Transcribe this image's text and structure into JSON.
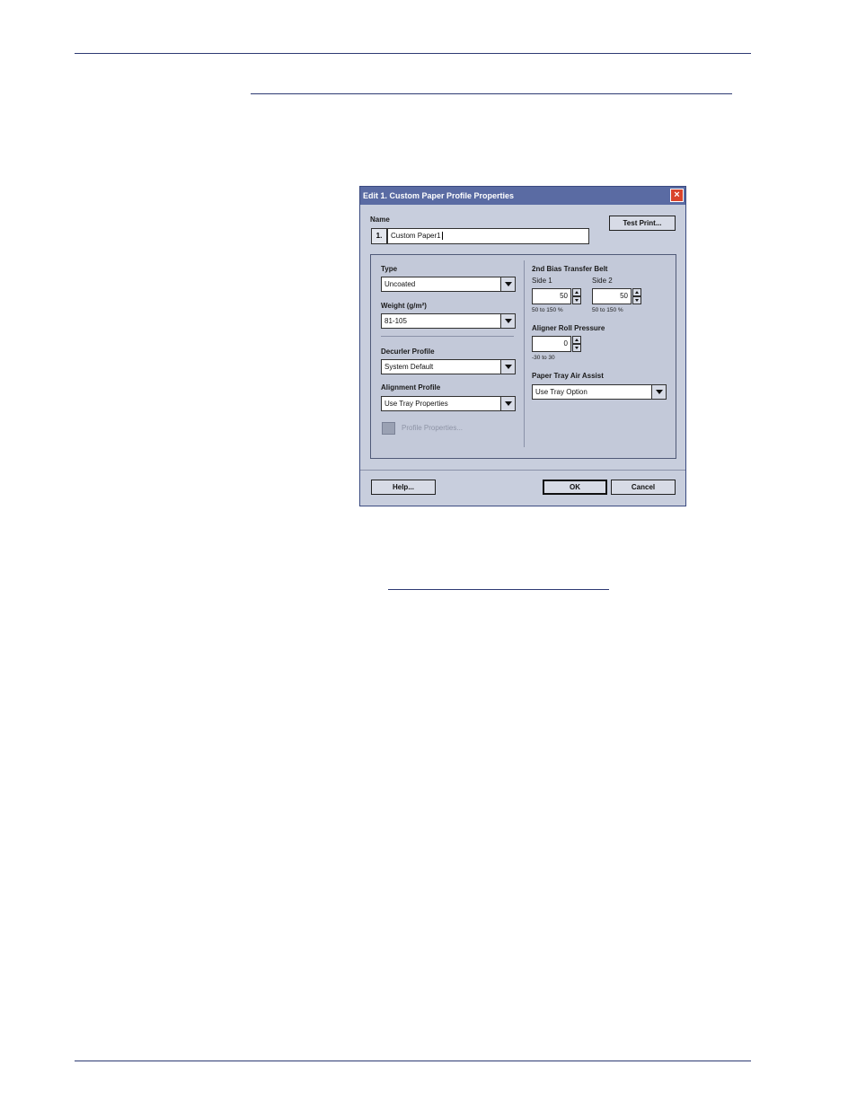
{
  "dialog": {
    "title": "Edit 1. Custom Paper Profile Properties",
    "close_glyph": "×",
    "name_label": "Name",
    "name_index": "1.",
    "name_value": "Custom Paper1",
    "test_print_label": "Test Print...",
    "type_label": "Type",
    "type_value": "Uncoated",
    "weight_label": "Weight (g/m²)",
    "weight_value": "81-105",
    "decurler_label": "Decurler Profile",
    "decurler_value": "System Default",
    "alignment_label": "Alignment Profile",
    "alignment_value": "Use Tray Properties",
    "profile_properties_label": "Profile Properties...",
    "bias_label": "2nd Bias Transfer Belt",
    "side1_label": "Side 1",
    "side1_value": "50",
    "side1_hint": "50 to 150 %",
    "side2_label": "Side 2",
    "side2_value": "50",
    "side2_hint": "50 to 150 %",
    "aligner_label": "Aligner Roll Pressure",
    "aligner_value": "0",
    "aligner_hint": "-30 to 30",
    "air_assist_label": "Paper Tray Air Assist",
    "air_assist_value": "Use Tray Option",
    "help_label": "Help...",
    "ok_label": "OK",
    "cancel_label": "Cancel"
  },
  "colors": {
    "titlebar": "#5a6ba3",
    "dialog_bg": "#c8cedd",
    "rule": "#2d3a73",
    "close": "#d9442c"
  }
}
